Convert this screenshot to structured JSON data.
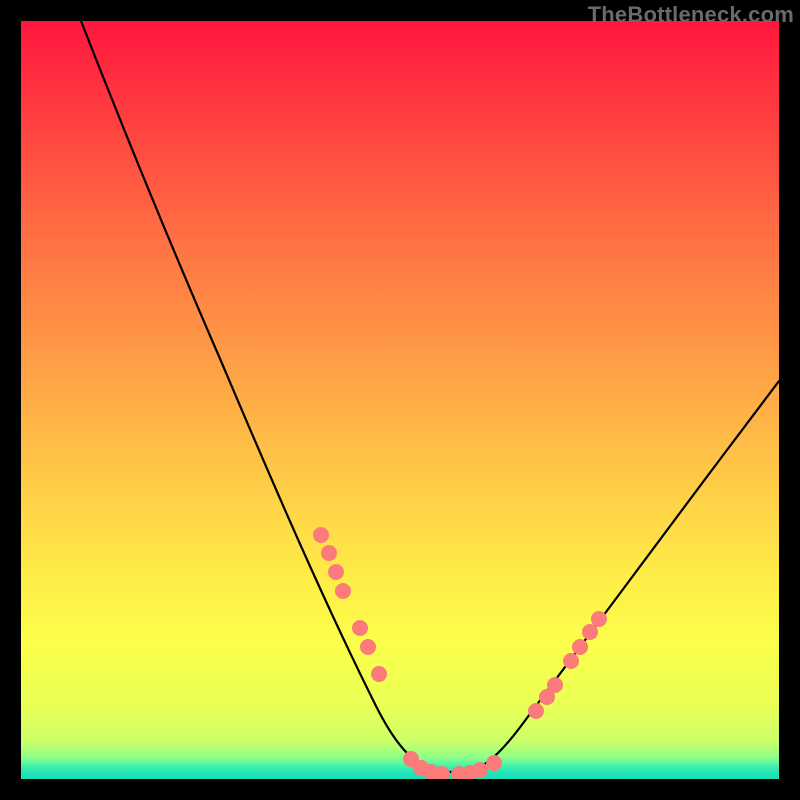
{
  "watermark": "TheBottleneck.com",
  "chart_data": {
    "type": "line",
    "title": "",
    "xlabel": "",
    "ylabel": "",
    "xlim": [
      0,
      100
    ],
    "ylim": [
      0,
      100
    ],
    "grid": false,
    "legend": false,
    "series": [
      {
        "name": "bottleneck-curve",
        "x": [
          8,
          12,
          16,
          20,
          24,
          28,
          32,
          36,
          40,
          44,
          48,
          50,
          52,
          54,
          56,
          58,
          60,
          64,
          68,
          72,
          76,
          80,
          84,
          88,
          92,
          96,
          100
        ],
        "y": [
          100,
          92,
          83,
          75,
          66,
          57,
          49,
          40,
          31,
          22,
          12,
          7,
          3,
          1,
          0,
          0,
          0,
          3,
          8,
          14,
          20,
          26,
          32,
          39,
          45,
          51,
          58
        ]
      }
    ],
    "markers": [
      {
        "name": "left-cluster",
        "color": "#fb7b7b",
        "points": [
          {
            "x": 39.7,
            "y": 32.0
          },
          {
            "x": 40.6,
            "y": 29.5
          },
          {
            "x": 41.6,
            "y": 27.0
          },
          {
            "x": 42.6,
            "y": 24.6
          },
          {
            "x": 44.7,
            "y": 19.8
          },
          {
            "x": 45.8,
            "y": 17.3
          },
          {
            "x": 47.3,
            "y": 13.7
          }
        ]
      },
      {
        "name": "trough-cluster",
        "color": "#fb7b7b",
        "points": [
          {
            "x": 51.5,
            "y": 2.5
          },
          {
            "x": 52.8,
            "y": 1.2
          },
          {
            "x": 54.1,
            "y": 0.6
          },
          {
            "x": 55.5,
            "y": 0.2
          },
          {
            "x": 57.8,
            "y": 0.2
          },
          {
            "x": 59.2,
            "y": 0.4
          },
          {
            "x": 60.6,
            "y": 0.9
          },
          {
            "x": 62.4,
            "y": 1.8
          }
        ]
      },
      {
        "name": "right-cluster",
        "color": "#fb7b7b",
        "points": [
          {
            "x": 68.0,
            "y": 8.5
          },
          {
            "x": 69.4,
            "y": 10.5
          },
          {
            "x": 70.4,
            "y": 12.0
          },
          {
            "x": 72.5,
            "y": 15.2
          },
          {
            "x": 73.8,
            "y": 17.3
          },
          {
            "x": 75.1,
            "y": 19.2
          },
          {
            "x": 76.2,
            "y": 21.0
          }
        ]
      }
    ],
    "gradient_stops": [
      {
        "pos": 0.0,
        "color": "#ff163e"
      },
      {
        "pos": 0.2,
        "color": "#ff5541"
      },
      {
        "pos": 0.46,
        "color": "#ffa146"
      },
      {
        "pos": 0.72,
        "color": "#ffe948"
      },
      {
        "pos": 0.9,
        "color": "#eaff55"
      },
      {
        "pos": 0.97,
        "color": "#8dff88"
      },
      {
        "pos": 1.0,
        "color": "#19dfb8"
      }
    ]
  }
}
